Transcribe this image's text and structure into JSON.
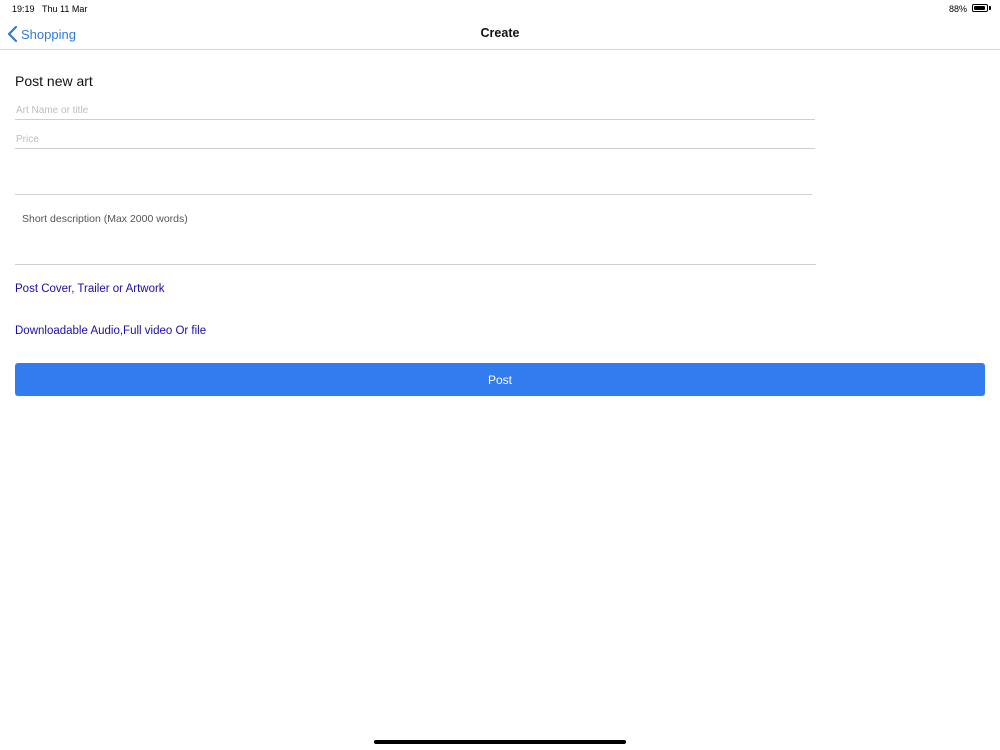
{
  "status_bar": {
    "time": "19:19",
    "date": "Thu 11 Mar",
    "battery_text": "88%",
    "battery_level": 0.88
  },
  "nav": {
    "back_label": "Shopping",
    "title": "Create",
    "accent_color": "#2f7bd5",
    "back_icon": "chevron-left-icon"
  },
  "form": {
    "section_title": "Post new art",
    "art_name": {
      "value": "",
      "placeholder": "Art Name or title"
    },
    "price": {
      "value": "",
      "placeholder": "Price"
    },
    "description": {
      "value": "",
      "placeholder": "Short description (Max 2000 words)"
    },
    "cover_link": "Post Cover, Trailer or Artwork",
    "download_link": "Downloadable Audio,Full video Or file",
    "post_button": "Post",
    "link_color": "#1a0dab",
    "button_color": "#337cf0"
  }
}
